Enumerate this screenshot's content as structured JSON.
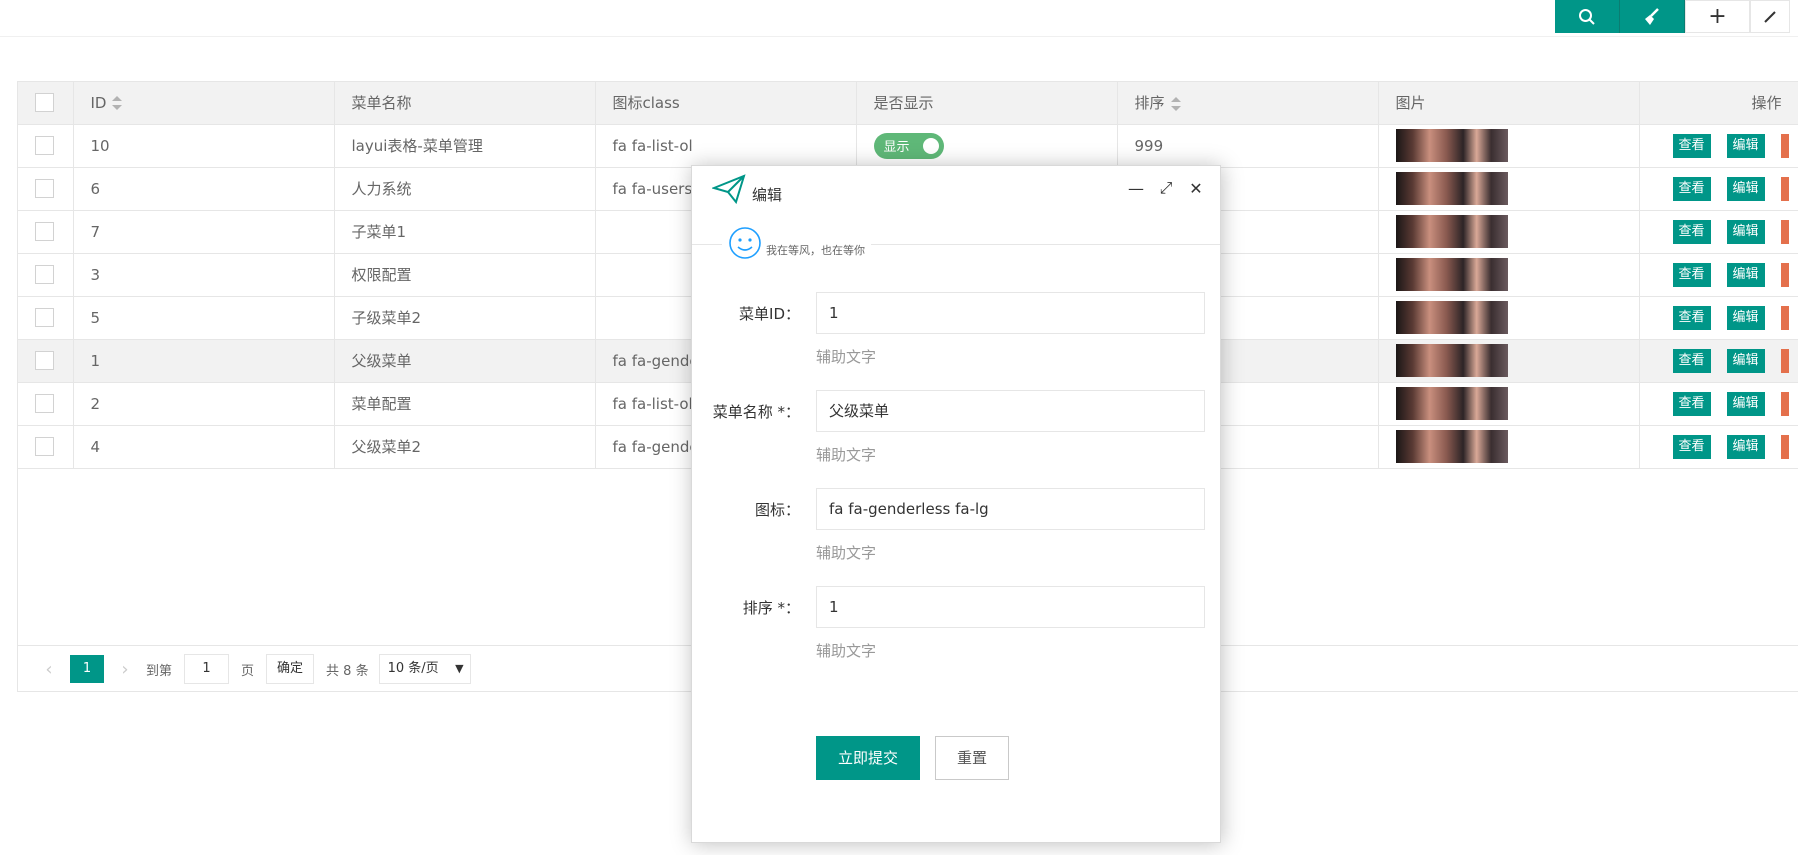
{
  "toolbar": {
    "search_icon": "search-icon",
    "clean_icon": "broom-icon",
    "add_label": "+"
  },
  "table": {
    "headers": {
      "id": "ID",
      "name": "菜单名称",
      "icon": "图标class",
      "show": "是否显示",
      "sort": "排序",
      "image": "图片",
      "ops": "操作"
    },
    "rows": [
      {
        "id": "10",
        "name": "layui表格-菜单管理",
        "icon": "fa fa-list-ol",
        "show": "显示",
        "sort": "999"
      },
      {
        "id": "6",
        "name": "人力系统",
        "icon": "fa fa-users",
        "show": "",
        "sort": ""
      },
      {
        "id": "7",
        "name": "子菜单1",
        "icon": "",
        "show": "",
        "sort": ""
      },
      {
        "id": "3",
        "name": "权限配置",
        "icon": "",
        "show": "",
        "sort": ""
      },
      {
        "id": "5",
        "name": "子级菜单2",
        "icon": "",
        "show": "",
        "sort": ""
      },
      {
        "id": "1",
        "name": "父级菜单",
        "icon": "fa fa-gende",
        "show": "",
        "sort": ""
      },
      {
        "id": "2",
        "name": "菜单配置",
        "icon": "fa fa-list-ol",
        "show": "",
        "sort": ""
      },
      {
        "id": "4",
        "name": "父级菜单2",
        "icon": "fa fa-gende",
        "show": "",
        "sort": ""
      }
    ],
    "view_label": "查看",
    "edit_label": "编辑"
  },
  "pager": {
    "current": "1",
    "goto_label": "到第",
    "goto_value": "1",
    "page_label": "页",
    "confirm_label": "确定",
    "total_label": "共 8 条",
    "page_size": "10 条/页"
  },
  "modal": {
    "title": "编辑",
    "legend": "我在等风，也在等你",
    "fields": [
      {
        "label": "菜单ID：",
        "value": "1",
        "aux": "辅助文字"
      },
      {
        "label": "菜单名称 *：",
        "value": "父级菜单",
        "aux": "辅助文字"
      },
      {
        "label": "图标：",
        "value": "fa fa-genderless fa-lg",
        "aux": "辅助文字"
      },
      {
        "label": "排序 *：",
        "value": "1",
        "aux": "辅助文字"
      }
    ],
    "submit_label": "立即提交",
    "reset_label": "重置"
  },
  "colors": {
    "primary": "#009688",
    "switch_on": "#5FB878",
    "danger": "#e4704c"
  }
}
